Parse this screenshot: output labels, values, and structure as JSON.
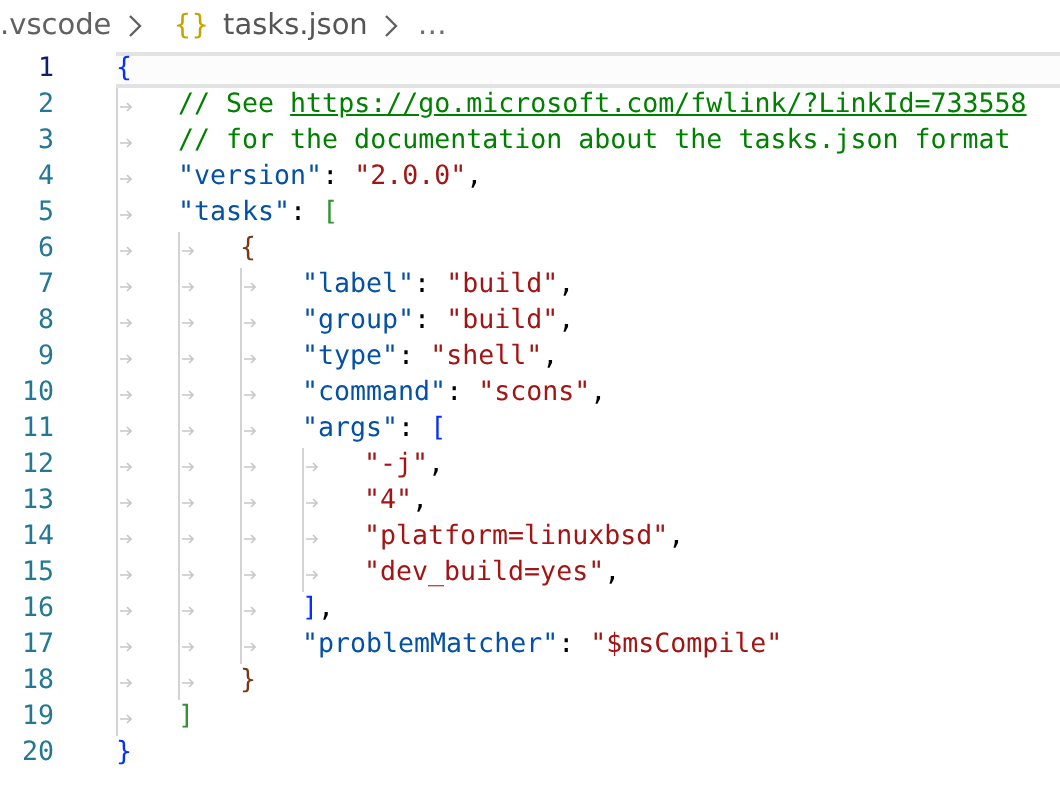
{
  "breadcrumb": [
    {
      "kind": "folder",
      "text": ".vscode"
    },
    {
      "kind": "file",
      "icon": "{}",
      "text": "tasks.json"
    },
    {
      "kind": "more",
      "text": "…"
    }
  ],
  "editor": {
    "lines": [
      {
        "number": "1",
        "current": true,
        "tokens": [
          {
            "kind": "bracket",
            "text": "{",
            "color": "#0431fa"
          }
        ],
        "children": [
          {
            "number": "2",
            "current": false,
            "tokens": [
              {
                "kind": "comment",
                "text": "// See "
              },
              {
                "kind": "link",
                "text": "https://go.microsoft.com/fwlink/?LinkId=733558"
              }
            ]
          },
          {
            "number": "3",
            "current": false,
            "tokens": [
              {
                "kind": "comment",
                "text": "// for the documentation about the tasks.json format"
              }
            ]
          },
          {
            "number": "4",
            "current": false,
            "tokens": [
              {
                "kind": "key",
                "text": "\"version\""
              },
              {
                "kind": "punct",
                "text": ":"
              },
              {
                "kind": "string",
                "text": "\"2.0.0\""
              },
              {
                "kind": "punct",
                "text": ","
              }
            ]
          },
          {
            "number": "5",
            "current": false,
            "tokens": [
              {
                "kind": "key",
                "text": "\"tasks\""
              },
              {
                "kind": "punct",
                "text": ":"
              },
              {
                "kind": "bracket",
                "text": "[",
                "color": "#319331"
              }
            ],
            "children": [
              {
                "number": "6",
                "current": false,
                "tokens": [
                  {
                    "kind": "bracket",
                    "text": "{",
                    "color": "#7b3814"
                  }
                ],
                "children": [
                  {
                    "number": "7",
                    "current": false,
                    "tokens": [
                      {
                        "kind": "key",
                        "text": "\"label\""
                      },
                      {
                        "kind": "punct",
                        "text": ":"
                      },
                      {
                        "kind": "string",
                        "text": "\"build\""
                      },
                      {
                        "kind": "punct",
                        "text": ","
                      }
                    ]
                  },
                  {
                    "number": "8",
                    "current": false,
                    "tokens": [
                      {
                        "kind": "key",
                        "text": "\"group\""
                      },
                      {
                        "kind": "punct",
                        "text": ":"
                      },
                      {
                        "kind": "string",
                        "text": "\"build\""
                      },
                      {
                        "kind": "punct",
                        "text": ","
                      }
                    ]
                  },
                  {
                    "number": "9",
                    "current": false,
                    "tokens": [
                      {
                        "kind": "key",
                        "text": "\"type\""
                      },
                      {
                        "kind": "punct",
                        "text": ":"
                      },
                      {
                        "kind": "string",
                        "text": "\"shell\""
                      },
                      {
                        "kind": "punct",
                        "text": ","
                      }
                    ]
                  },
                  {
                    "number": "10",
                    "current": false,
                    "tokens": [
                      {
                        "kind": "key",
                        "text": "\"command\""
                      },
                      {
                        "kind": "punct",
                        "text": ":"
                      },
                      {
                        "kind": "string",
                        "text": "\"scons\""
                      },
                      {
                        "kind": "punct",
                        "text": ","
                      }
                    ]
                  },
                  {
                    "number": "11",
                    "current": false,
                    "tokens": [
                      {
                        "kind": "key",
                        "text": "\"args\""
                      },
                      {
                        "kind": "punct",
                        "text": ":"
                      },
                      {
                        "kind": "bracket",
                        "text": "[",
                        "color": "#0431fa"
                      }
                    ],
                    "children": [
                      {
                        "number": "12",
                        "current": false,
                        "tokens": [
                          {
                            "kind": "string",
                            "text": "\"-j\""
                          },
                          {
                            "kind": "punct",
                            "text": ","
                          }
                        ]
                      },
                      {
                        "number": "13",
                        "current": false,
                        "tokens": [
                          {
                            "kind": "string",
                            "text": "\"4\""
                          },
                          {
                            "kind": "punct",
                            "text": ","
                          }
                        ]
                      },
                      {
                        "number": "14",
                        "current": false,
                        "tokens": [
                          {
                            "kind": "string",
                            "text": "\"platform=linuxbsd\""
                          },
                          {
                            "kind": "punct",
                            "text": ","
                          }
                        ]
                      },
                      {
                        "number": "15",
                        "current": false,
                        "tokens": [
                          {
                            "kind": "string",
                            "text": "\"dev_build=yes\""
                          },
                          {
                            "kind": "punct",
                            "text": ","
                          }
                        ]
                      }
                    ]
                  },
                  {
                    "number": "16",
                    "current": false,
                    "tokens": [
                      {
                        "kind": "bracket",
                        "text": "]",
                        "color": "#0431fa"
                      },
                      {
                        "kind": "punct",
                        "text": ","
                      }
                    ]
                  },
                  {
                    "number": "17",
                    "current": false,
                    "tokens": [
                      {
                        "kind": "key",
                        "text": "\"problemMatcher\""
                      },
                      {
                        "kind": "punct",
                        "text": ":"
                      },
                      {
                        "kind": "string",
                        "text": "\"$msCompile\""
                      }
                    ]
                  }
                ]
              },
              {
                "number": "18",
                "current": false,
                "tokens": [
                  {
                    "kind": "bracket",
                    "text": "}",
                    "color": "#7b3814"
                  }
                ]
              }
            ]
          },
          {
            "number": "19",
            "current": false,
            "tokens": [
              {
                "kind": "bracket",
                "text": "]",
                "color": "#319331"
              }
            ]
          }
        ]
      },
      {
        "number": "20",
        "current": false,
        "tokens": [
          {
            "kind": "bracket",
            "text": "}",
            "color": "#0431fa"
          }
        ]
      }
    ]
  }
}
